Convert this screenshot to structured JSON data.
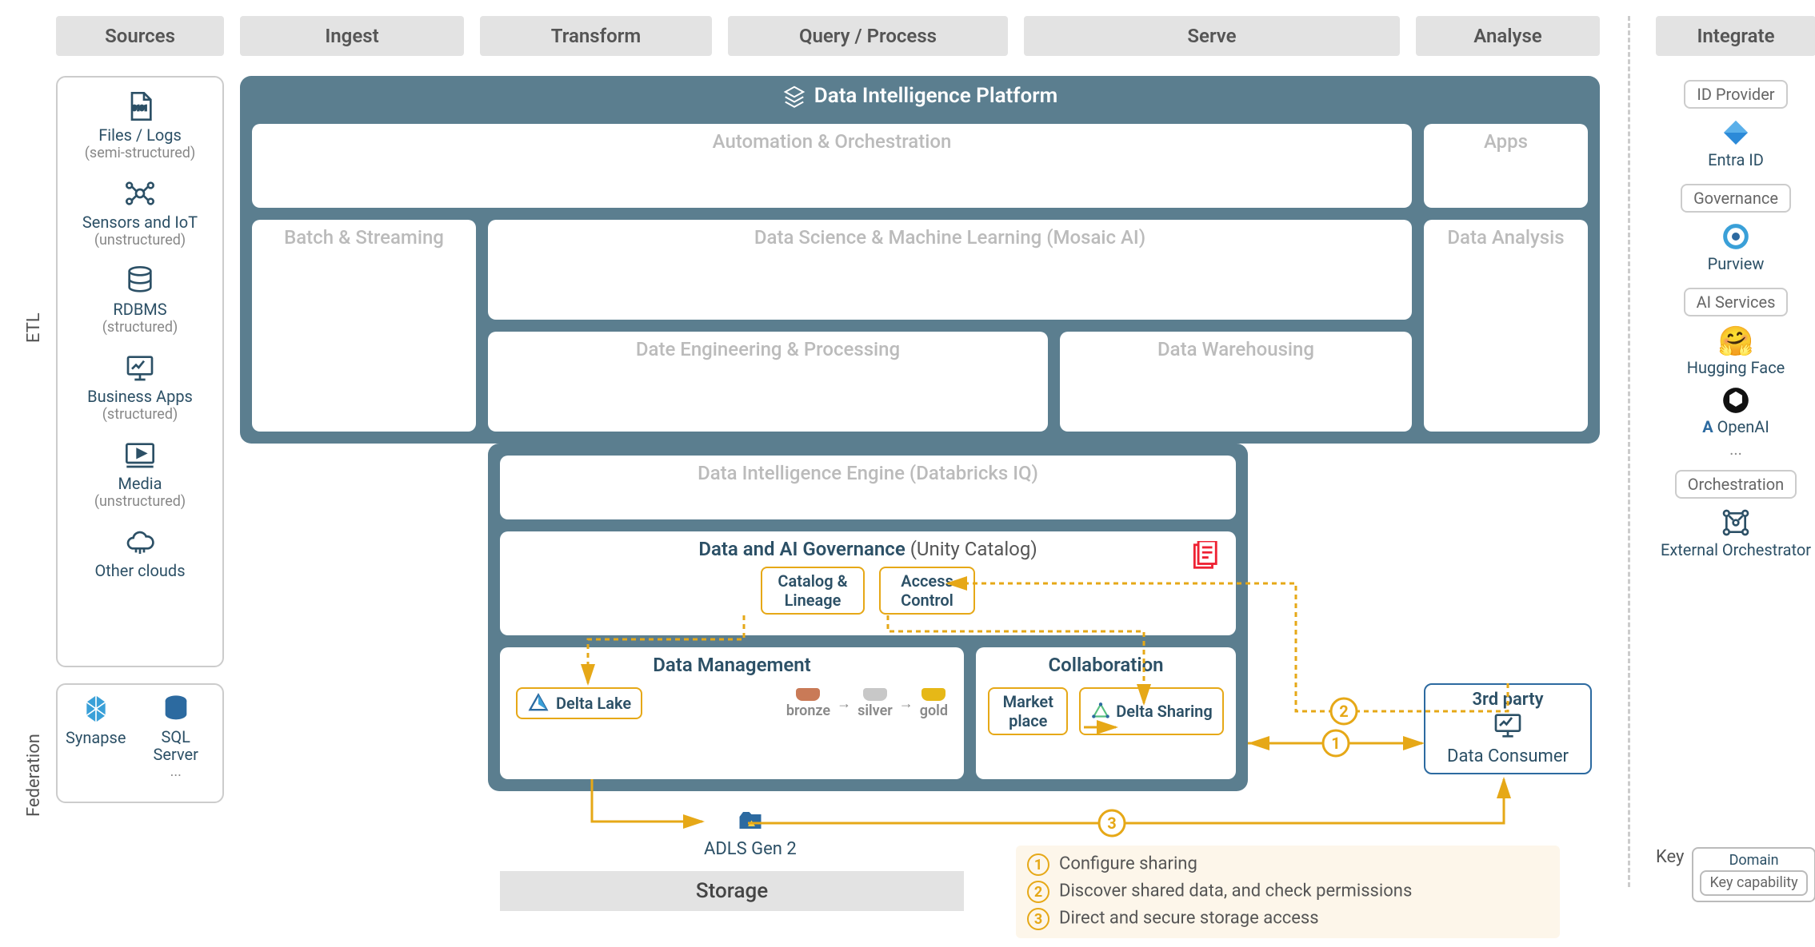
{
  "stages": {
    "sources": "Sources",
    "ingest": "Ingest",
    "transform": "Transform",
    "query": "Query / Process",
    "serve": "Serve",
    "analyse": "Analyse",
    "integrate": "Integrate"
  },
  "side_labels": {
    "etl": "ETL",
    "federation": "Federation"
  },
  "sources": {
    "files": {
      "title": "Files / Logs",
      "sub": "(semi-structured)"
    },
    "sensors": {
      "title": "Sensors and IoT",
      "sub": "(unstructured)"
    },
    "rdbms": {
      "title": "RDBMS",
      "sub": "(structured)"
    },
    "bapps": {
      "title": "Business Apps",
      "sub": "(structured)"
    },
    "media": {
      "title": "Media",
      "sub": "(unstructured)"
    },
    "clouds": {
      "title": "Other clouds"
    },
    "fed": {
      "synapse": "Synapse",
      "sqlserver": "SQL Server",
      "more": "..."
    }
  },
  "platform": {
    "title": "Data Intelligence Platform",
    "automation": "Automation & Orchestration",
    "apps": "Apps",
    "batch": "Batch & Streaming",
    "dsml": "Data Science & Machine Learning  (Mosaic AI)",
    "analysis": "Data Analysis",
    "eng": "Date Engineering & Processing",
    "dwh": "Data Warehousing",
    "engine": "Data Intelligence Engine  (Databricks IQ)",
    "gov": {
      "title": "Data and AI Governance",
      "sub": "(Unity Catalog)",
      "catalog": "Catalog & Lineage",
      "access": "Access Control"
    },
    "dm": {
      "title": "Data Management",
      "delta": "Delta Lake",
      "bronze": "bronze",
      "silver": "silver",
      "gold": "gold"
    },
    "collab": {
      "title": "Collaboration",
      "market": "Market place",
      "share": "Delta Sharing"
    }
  },
  "third_party": {
    "title": "3rd party",
    "consumer": "Data Consumer"
  },
  "storage": {
    "adls": "ADLS Gen 2",
    "bar": "Storage"
  },
  "legend": {
    "key": "Key",
    "domain": "Domain",
    "cap": "Key capability",
    "n1": "1",
    "t1": "Configure sharing",
    "n2": "2",
    "t2": "Discover shared data, and check permissions",
    "n3": "3",
    "t3": "Direct and secure storage access"
  },
  "integrate": {
    "idp": "ID Provider",
    "entra": "Entra ID",
    "gov": "Governance",
    "purview": "Purview",
    "ai": "AI Services",
    "hf": "Hugging Face",
    "openai": "OpenAI",
    "more": "...",
    "orch": "Orchestration",
    "ext": "External Orchestrator"
  }
}
